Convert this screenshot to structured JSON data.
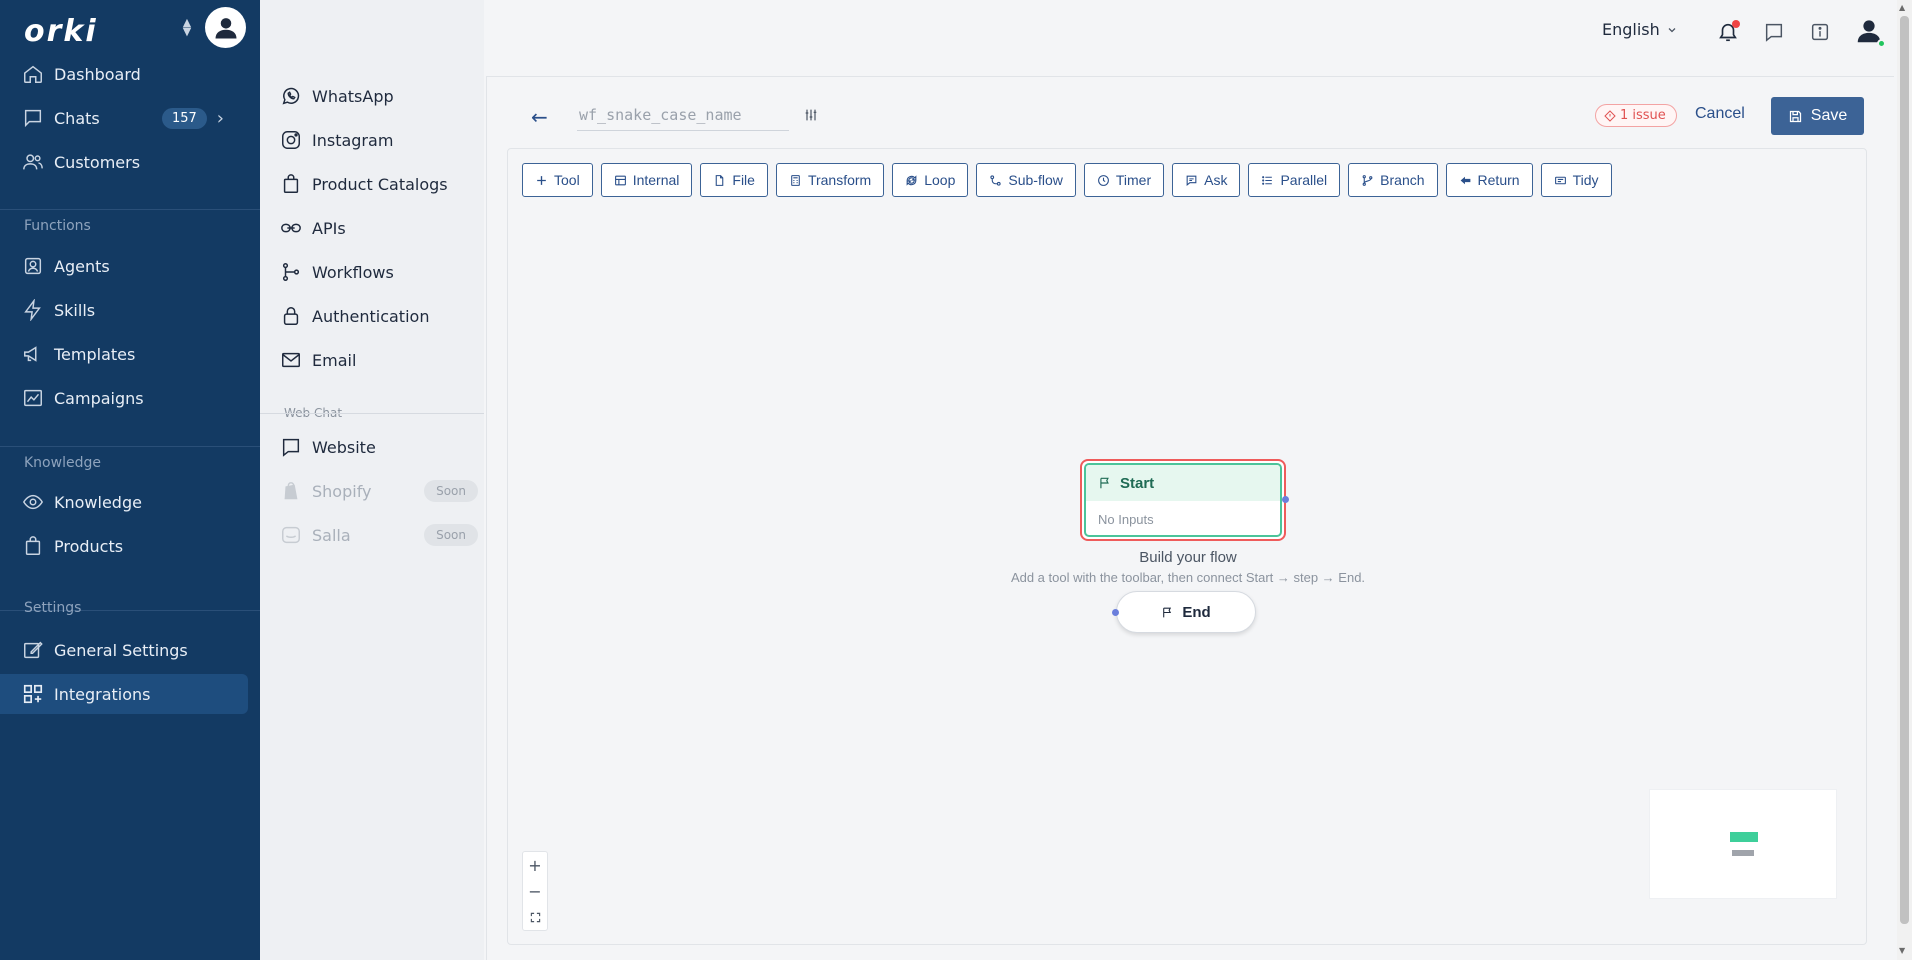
{
  "brand": {
    "logo": "orki"
  },
  "sidebar": {
    "items": [
      {
        "label": "Dashboard",
        "icon": "home-icon"
      },
      {
        "label": "Chats",
        "icon": "chat-icon",
        "badge": "157"
      },
      {
        "label": "Customers",
        "icon": "users-icon"
      },
      {
        "label": "Agents",
        "icon": "agent-icon"
      },
      {
        "label": "Skills",
        "icon": "bolt-icon"
      },
      {
        "label": "Templates",
        "icon": "megaphone-icon"
      },
      {
        "label": "Campaigns",
        "icon": "chart-icon"
      },
      {
        "label": "Knowledge",
        "icon": "eye-icon"
      },
      {
        "label": "Products",
        "icon": "bag-icon"
      },
      {
        "label": "General Settings",
        "icon": "edit-icon"
      },
      {
        "label": "Integrations",
        "icon": "grid-plus-icon",
        "active": true
      }
    ],
    "sections": {
      "functions": "Functions",
      "knowledge": "Knowledge",
      "settings": "Settings"
    }
  },
  "subnav": {
    "items": [
      {
        "label": "WhatsApp"
      },
      {
        "label": "Instagram"
      },
      {
        "label": "Product Catalogs"
      },
      {
        "label": "APIs"
      },
      {
        "label": "Workflows"
      },
      {
        "label": "Authentication"
      },
      {
        "label": "Email"
      }
    ],
    "webchat_label": "Web Chat",
    "webchat_items": [
      {
        "label": "Website"
      },
      {
        "label": "Shopify",
        "tag": "Soon"
      },
      {
        "label": "Salla",
        "tag": "Soon"
      }
    ]
  },
  "topbar": {
    "language": "English"
  },
  "editor": {
    "name_placeholder": "wf_snake_case_name",
    "issue": "1 issue",
    "cancel": "Cancel",
    "save": "Save"
  },
  "toolbar": {
    "tool": "Tool",
    "internal": "Internal",
    "file": "File",
    "transform": "Transform",
    "loop": "Loop",
    "subflow": "Sub-flow",
    "timer": "Timer",
    "ask": "Ask",
    "parallel": "Parallel",
    "branch": "Branch",
    "return": "Return",
    "tidy": "Tidy"
  },
  "canvas": {
    "start_title": "Start",
    "start_body": "No Inputs",
    "build_title": "Build your flow",
    "build_sub": "Add a tool with the toolbar, then connect Start → step → End.",
    "end_title": "End"
  },
  "colors": {
    "sidebar": "#133a63",
    "accent": "#3c6396",
    "start": "#4cc49a",
    "error": "#ef5b5b"
  }
}
